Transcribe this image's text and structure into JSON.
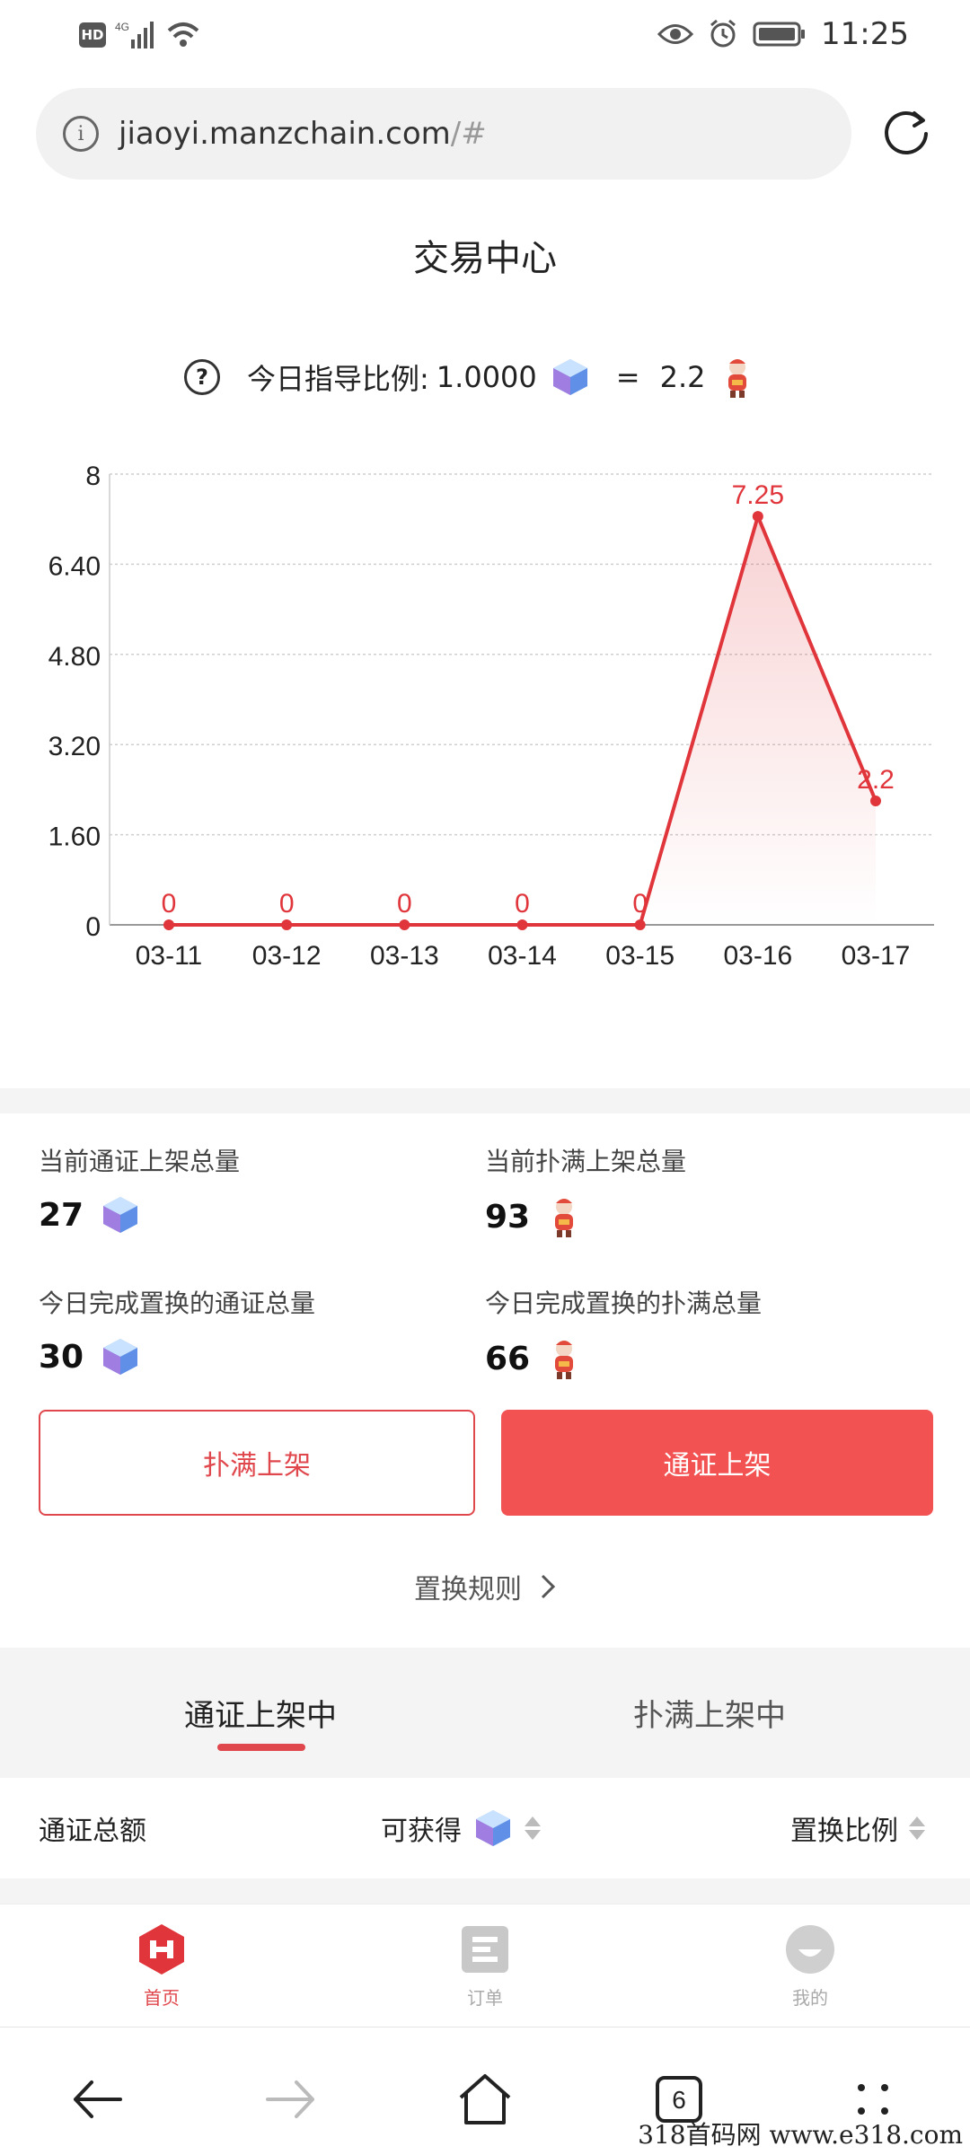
{
  "status_bar": {
    "hd": "HD",
    "network": "4G",
    "time": "11:25"
  },
  "browser": {
    "url_host": "jiaoyi.manzchain.com",
    "url_hash": "/#"
  },
  "page": {
    "title": "交易中心"
  },
  "ratio": {
    "label": "今日指导比例:",
    "left_value": "1.0000",
    "equals": "=",
    "right_value": "2.2"
  },
  "chart_data": {
    "type": "line",
    "categories": [
      "03-11",
      "03-12",
      "03-13",
      "03-14",
      "03-15",
      "03-16",
      "03-17"
    ],
    "values": [
      0,
      0,
      0,
      0,
      0,
      7.25,
      2.2
    ],
    "data_labels": [
      "0",
      "0",
      "0",
      "0",
      "0",
      "7.25",
      "2.2"
    ],
    "y_ticks": [
      "0",
      "1.60",
      "3.20",
      "4.80",
      "6.40",
      "8"
    ],
    "ylim": [
      0,
      8
    ],
    "grid": true,
    "area_fill": true,
    "line_color": "#e0353b"
  },
  "stats": [
    {
      "label": "当前通证上架总量",
      "value": "27",
      "icon": "gem-icon"
    },
    {
      "label": "当前扑满上架总量",
      "value": "93",
      "icon": "figure-icon"
    },
    {
      "label": "今日完成置换的通证总量",
      "value": "30",
      "icon": "gem-icon"
    },
    {
      "label": "今日完成置换的扑满总量",
      "value": "66",
      "icon": "figure-icon"
    }
  ],
  "buttons": {
    "left": "扑满上架",
    "right": "通证上架"
  },
  "rules_link": "置换规则",
  "tabs": [
    "通证上架中",
    "扑满上架中"
  ],
  "list_header": {
    "col1": "通证总额",
    "col2": "可获得",
    "col3": "置换比例"
  },
  "bottom_nav": [
    {
      "label": "首页",
      "icon": "home-icon"
    },
    {
      "label": "订单",
      "icon": "orders-icon"
    },
    {
      "label": "我的",
      "icon": "profile-icon"
    }
  ],
  "system_nav": {
    "tab_count": "6"
  },
  "watermark": "318首码网  www.e318.com",
  "colors": {
    "accent": "#e0474c",
    "accent_fill": "#f35252",
    "divider": "#f4f4f5"
  }
}
